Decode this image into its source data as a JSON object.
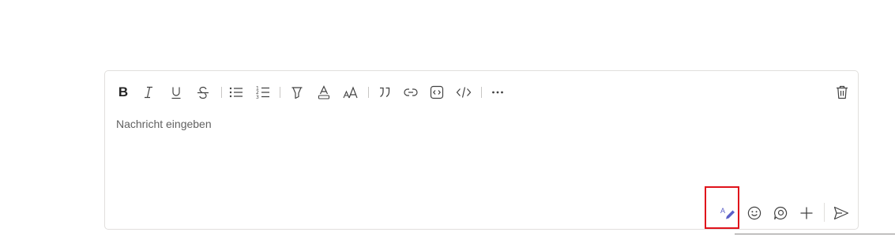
{
  "composer": {
    "placeholder": "Nachricht eingeben",
    "placeholder_color": "#616161",
    "border_color": "#e1dfdd"
  },
  "toolbar": {
    "buttons": [
      {
        "name": "bold",
        "icon": "bold-icon",
        "label": "B"
      },
      {
        "name": "italic",
        "icon": "italic-icon",
        "label": "I"
      },
      {
        "name": "underline",
        "icon": "underline-icon",
        "label": "U"
      },
      {
        "name": "strikethrough",
        "icon": "strikethrough-icon",
        "label": "S"
      },
      {
        "name": "bullet-list",
        "icon": "bullet-list-icon"
      },
      {
        "name": "numbered-list",
        "icon": "numbered-list-icon"
      },
      {
        "name": "highlight",
        "icon": "highlighter-icon"
      },
      {
        "name": "font-color",
        "icon": "font-color-icon"
      },
      {
        "name": "font-size",
        "icon": "font-size-icon"
      },
      {
        "name": "quote",
        "icon": "quote-icon"
      },
      {
        "name": "link",
        "icon": "link-icon"
      },
      {
        "name": "code-snippet",
        "icon": "code-block-icon"
      },
      {
        "name": "code",
        "icon": "code-icon"
      },
      {
        "name": "more-options",
        "icon": "more-options-icon"
      },
      {
        "name": "discard",
        "icon": "trash-icon"
      }
    ],
    "icon_color": "#424242"
  },
  "actions": [
    {
      "name": "format",
      "icon": "format-pen-icon",
      "active": true,
      "color": "#5b5fc7"
    },
    {
      "name": "emoji",
      "icon": "emoji-icon"
    },
    {
      "name": "loop",
      "icon": "loop-icon"
    },
    {
      "name": "attach",
      "icon": "plus-icon"
    },
    {
      "name": "send",
      "icon": "send-icon"
    }
  ],
  "highlight_color": "#e0121b"
}
